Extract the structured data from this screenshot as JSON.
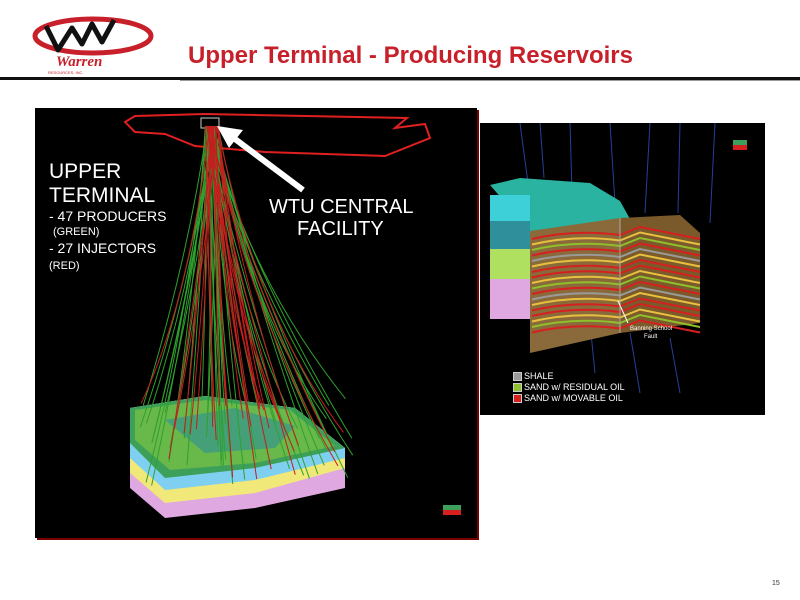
{
  "header": {
    "logo_text": "Warren",
    "logo_subtext": "RESOURCES, INC.",
    "title": "Upper Terminal - Producing Reservoirs"
  },
  "left_figure": {
    "label_upper": "UPPER",
    "label_terminal": "TERMINAL",
    "producers": "- 47 PRODUCERS",
    "producers_color": "(GREEN)",
    "injectors": "- 27 INJECTORS",
    "injectors_color": "(RED)",
    "facility_line1": "WTU CENTRAL",
    "facility_line2": "FACILITY"
  },
  "right_figure": {
    "fault_line1": "Banning School",
    "fault_line2": "Fault",
    "legend": [
      {
        "label": "SHALE",
        "color": "#9a9a9a"
      },
      {
        "label": "SAND w/ RESIDUAL OIL",
        "color": "#8fbf2a"
      },
      {
        "label": "SAND w/ MOVABLE OIL",
        "color": "#d62020"
      }
    ]
  },
  "footer": {
    "page_number": "15"
  },
  "colors": {
    "title": "#c8202a",
    "producers": "#2fa02f",
    "injectors": "#c41e1e"
  }
}
